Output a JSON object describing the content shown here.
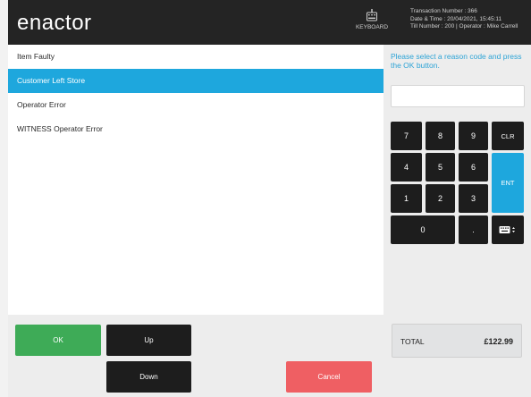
{
  "header": {
    "logo_text": "enactor",
    "keyboard_label": "KEYBOARD",
    "transaction_line": "Transaction Number : 366",
    "datetime_line": "Date & Time : 20/04/2021, 15:45:11",
    "till_line": "Till Number : 200 | Operator : Mike Carrell"
  },
  "reasons": {
    "items": [
      {
        "label": "Item Faulty",
        "selected": false
      },
      {
        "label": "Customer Left Store",
        "selected": true
      },
      {
        "label": "Operator Error",
        "selected": false
      },
      {
        "label": "WITNESS Operator Error",
        "selected": false
      }
    ]
  },
  "buttons": {
    "ok": "OK",
    "up": "Up",
    "down": "Down",
    "cancel": "Cancel"
  },
  "keypad": {
    "prompt": "Please select a reason code and press the OK button.",
    "entry_value": "",
    "keys": {
      "k7": "7",
      "k8": "8",
      "k9": "9",
      "clr": "CLR",
      "k4": "4",
      "k5": "5",
      "k6": "6",
      "ent": "ENT",
      "k1": "1",
      "k2": "2",
      "k3": "3",
      "k0": "0",
      "dot": "."
    }
  },
  "total": {
    "label": "TOTAL",
    "value": "£122.99"
  },
  "colors": {
    "header_bg": "#242424",
    "selected_row": "#1ea7dd",
    "ok_button": "#3eab57",
    "cancel_button": "#ef5f63",
    "key_bg": "#1d1d1d",
    "prompt_text": "#2ea4d6"
  }
}
